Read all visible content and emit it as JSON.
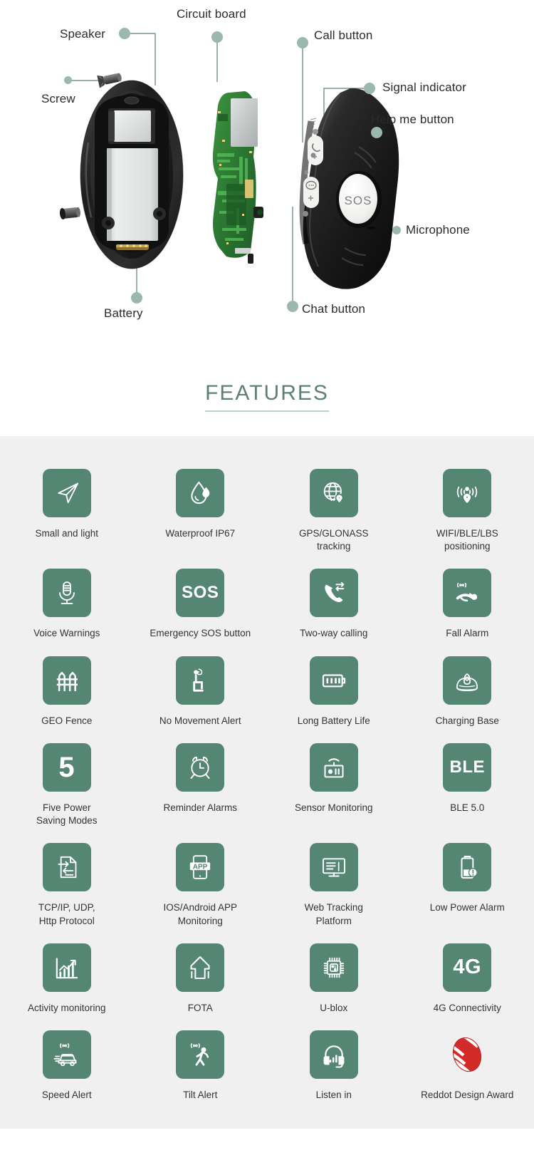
{
  "diagram": {
    "callouts": [
      {
        "id": "speaker",
        "label": "Speaker"
      },
      {
        "id": "circuit-board",
        "label": "Circuit board"
      },
      {
        "id": "call-button",
        "label": "Call button"
      },
      {
        "id": "signal-indicator",
        "label": "Signal indicator"
      },
      {
        "id": "help-me-button",
        "label": "Help me button"
      },
      {
        "id": "screw",
        "label": "Screw"
      },
      {
        "id": "microphone",
        "label": "Microphone"
      },
      {
        "id": "battery",
        "label": "Battery"
      },
      {
        "id": "chat-button",
        "label": "Chat button"
      }
    ],
    "device": {
      "sos_label": "SOS"
    },
    "colors": {
      "dot": "#9ab8ac",
      "leader_line": "#5d7f74",
      "label_text": "#2b2b2b"
    }
  },
  "section": {
    "title": "FEATURES",
    "title_color": "#5d7f74",
    "underline_color": "#b9cfc5",
    "background": "#f0f0f0",
    "tile_color": "#558573",
    "tile_icon_color": "#ffffff"
  },
  "features": {
    "rows": [
      [
        {
          "icon": "paper-plane-icon",
          "label": "Small and light"
        },
        {
          "icon": "water-drop-icon",
          "label": "Waterproof IP67"
        },
        {
          "icon": "globe-pin-icon",
          "label": "GPS/GLONASS\ntracking"
        },
        {
          "icon": "signal-pin-icon",
          "label": "WIFI/BLE/LBS\npositioning"
        }
      ],
      [
        {
          "icon": "microphone-icon",
          "label": "Voice Warnings"
        },
        {
          "icon": "sos-text-icon",
          "label": "Emergency SOS button",
          "text": "SOS"
        },
        {
          "icon": "two-way-call-icon",
          "label": "Two-way calling"
        },
        {
          "icon": "fall-alarm-icon",
          "label": "Fall Alarm"
        }
      ],
      [
        {
          "icon": "fence-icon",
          "label": "GEO Fence"
        },
        {
          "icon": "no-movement-icon",
          "label": "No Movement Alert"
        },
        {
          "icon": "battery-full-icon",
          "label": "Long Battery Life"
        },
        {
          "icon": "charging-base-icon",
          "label": "Charging Base"
        }
      ],
      [
        {
          "icon": "number-five-icon",
          "label": "Five Power\nSaving Modes",
          "text": "5"
        },
        {
          "icon": "alarm-clock-icon",
          "label": "Reminder Alarms"
        },
        {
          "icon": "sensor-icon",
          "label": "Sensor Monitoring"
        },
        {
          "icon": "ble-text-icon",
          "label": "BLE 5.0",
          "text": "BLE"
        }
      ],
      [
        {
          "icon": "protocol-transfer-icon",
          "label": "TCP/IP, UDP,\nHttp Protocol"
        },
        {
          "icon": "app-phone-icon",
          "label": "IOS/Android APP\nMonitoring",
          "text": "APP"
        },
        {
          "icon": "web-monitor-icon",
          "label": "Web Tracking\nPlatform"
        },
        {
          "icon": "low-battery-icon",
          "label": "Low Power Alarm"
        }
      ],
      [
        {
          "icon": "activity-chart-icon",
          "label": "Activity monitoring"
        },
        {
          "icon": "fota-arrow-icon",
          "label": "FOTA"
        },
        {
          "icon": "chip-icon",
          "label": "U-blox"
        },
        {
          "icon": "four-g-text-icon",
          "label": "4G Connectivity",
          "text": "4G"
        }
      ],
      [
        {
          "icon": "speed-car-icon",
          "label": "Speed Alert"
        },
        {
          "icon": "tilt-person-icon",
          "label": "Tilt Alert"
        },
        {
          "icon": "headset-icon",
          "label": "Listen in"
        },
        {
          "icon": "reddot-award-icon",
          "label": "Reddot Design Award"
        }
      ]
    ]
  }
}
